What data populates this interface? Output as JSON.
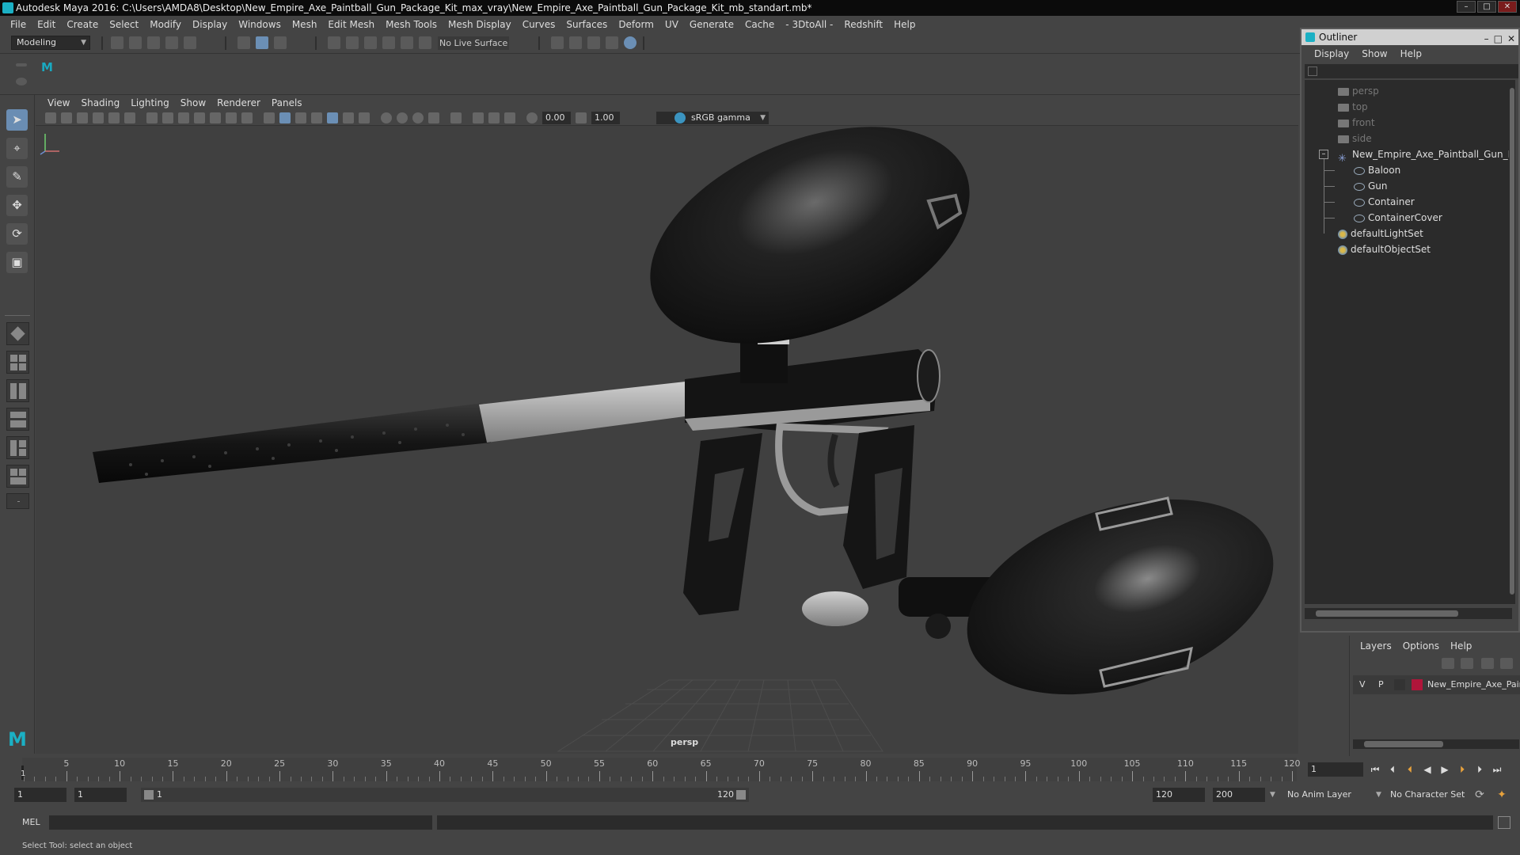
{
  "window": {
    "title": "Autodesk Maya 2016: C:\\Users\\AMDA8\\Desktop\\New_Empire_Axe_Paintball_Gun_Package_Kit_max_vray\\New_Empire_Axe_Paintball_Gun_Package_Kit_mb_standart.mb*",
    "min": "–",
    "max": "□",
    "close": "✕"
  },
  "menubar": [
    "File",
    "Edit",
    "Create",
    "Select",
    "Modify",
    "Display",
    "Windows",
    "Mesh",
    "Edit Mesh",
    "Mesh Tools",
    "Mesh Display",
    "Curves",
    "Surfaces",
    "Deform",
    "UV",
    "Generate",
    "Cache",
    "- 3DtoAll -",
    "Redshift",
    "Help"
  ],
  "shelf": {
    "mode": "Modeling",
    "live_surface": "No Live Surface"
  },
  "panel": {
    "menu": [
      "View",
      "Shading",
      "Lighting",
      "Show",
      "Renderer",
      "Panels"
    ],
    "exposure": "0.00",
    "gamma": "1.00",
    "color_space": "sRGB gamma",
    "camera": "persp"
  },
  "outliner": {
    "title": "Outliner",
    "menu": [
      "Display",
      "Show",
      "Help"
    ],
    "items": [
      {
        "label": "persp",
        "type": "camera"
      },
      {
        "label": "top",
        "type": "camera"
      },
      {
        "label": "front",
        "type": "camera"
      },
      {
        "label": "side",
        "type": "camera"
      },
      {
        "label": "New_Empire_Axe_Paintball_Gun_Packa",
        "type": "group"
      },
      {
        "label": "Baloon",
        "type": "mesh"
      },
      {
        "label": "Gun",
        "type": "mesh"
      },
      {
        "label": "Container",
        "type": "mesh"
      },
      {
        "label": "ContainerCover",
        "type": "mesh"
      },
      {
        "label": "defaultLightSet",
        "type": "set"
      },
      {
        "label": "defaultObjectSet",
        "type": "set"
      }
    ]
  },
  "layers": {
    "menu": [
      "Layers",
      "Options",
      "Help"
    ],
    "row": {
      "v": "V",
      "p": "P",
      "name": "New_Empire_Axe_Paint",
      "color": "#b0153a"
    }
  },
  "timeline": {
    "ticks": [
      "5",
      "10",
      "15",
      "20",
      "25",
      "30",
      "35",
      "40",
      "45",
      "50",
      "55",
      "60",
      "65",
      "70",
      "75",
      "80",
      "85",
      "90",
      "95",
      "100",
      "105",
      "110",
      "115",
      "120"
    ],
    "current_frame_label": "1",
    "current_frame": "1"
  },
  "range": {
    "start": "1",
    "playback_start": "1",
    "slider_start": "1",
    "slider_end": "120",
    "playback_end": "120",
    "end": "200",
    "anim_layer": "No Anim Layer",
    "character_set": "No Character Set"
  },
  "command": {
    "lang": "MEL"
  },
  "helpline": "Select Tool: select an object",
  "brand": {
    "maya": "M",
    "accent": "#1bb0c4"
  }
}
